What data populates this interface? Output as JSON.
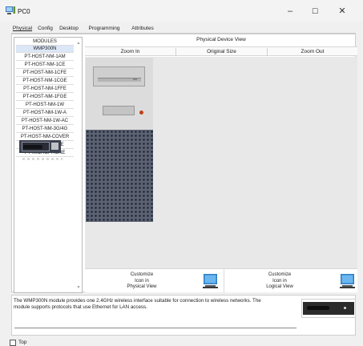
{
  "window": {
    "title": "PC0",
    "icon": "pc-icon",
    "controls": {
      "minimize": "–",
      "maximize": "☐",
      "close": "✕"
    }
  },
  "tabs": [
    {
      "label": "Physical",
      "active": true
    },
    {
      "label": "Config",
      "active": false
    },
    {
      "label": "Desktop",
      "active": false
    },
    {
      "label": "Programming",
      "active": false
    },
    {
      "label": "Attributes",
      "active": false
    }
  ],
  "modules": {
    "header": "MODULES",
    "items": [
      "WMP300N",
      "PT-HOST-NM-1AM",
      "PT-HOST-NM-1CE",
      "PT-HOST-NM-1CFE",
      "PT-HOST-NM-1CGE",
      "PT-HOST-NM-1FFE",
      "PT-HOST-NM-1FGE",
      "PT-HOST-NM-1W",
      "PT-HOST-NM-1W-A",
      "PT-HOST-NM-1W-AC",
      "PT-HOST-NM-3G/4G",
      "PT-HOST-NM-COVER",
      "PT-HEADPHONE",
      "PT-MICROPHONE"
    ],
    "scroll_up": "▲",
    "scroll_down": "▼"
  },
  "device_view": {
    "title": "Physical Device View",
    "zoom_in": "Zoom In",
    "original_size": "Original Size",
    "zoom_out": "Zoom Out"
  },
  "customize": {
    "physical": {
      "line1": "Customize",
      "line2": "Icon in",
      "line3": "Physical View"
    },
    "logical": {
      "line1": "Customize",
      "line2": "Icon in",
      "line3": "Logical View"
    }
  },
  "description": {
    "line1": "The WMP300N module provides one 2.4GHz wireless interface suitable for connection to wireless networks. The",
    "line2": "module supports protocols that use Ethernet for LAN access."
  },
  "footer": {
    "top_label": "Top",
    "top_checked": false
  },
  "colors": {
    "accent_blue": "#2d7fc7",
    "power_led": "#c04018",
    "grille": "#5b6273"
  }
}
